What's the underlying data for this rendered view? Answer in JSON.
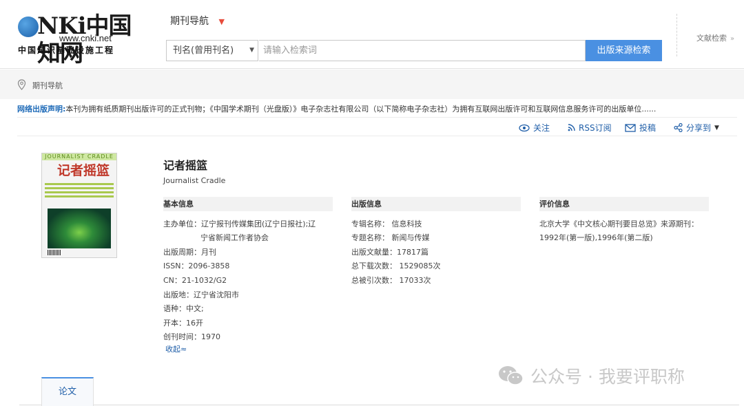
{
  "header": {
    "logo_brand": "CNKI中国知网",
    "logo_url": "www.cnki.net",
    "logo_sub": "中国知识基础设施工程",
    "nav_title": "期刊导航",
    "search_select": "刊名(曾用刊名)",
    "search_placeholder": "请输入检索词",
    "search_button": "出版来源检索",
    "lit_search": "文献检索"
  },
  "breadcrumb": {
    "label": "期刊导航"
  },
  "declaration": {
    "label": "网络出版声明:",
    "text": "本刊为拥有纸质期刊出版许可的正式刊物；《中国学术期刊（光盘版）》电子杂志社有限公司（以下简称电子杂志社）为拥有互联网出版许可和互联网信息服务许可的出版单位......"
  },
  "actions": {
    "follow": "关注",
    "rss": "RSS订阅",
    "submit": "投稿",
    "share": "分享到"
  },
  "cover": {
    "top_text": "JOURNALIST CRADLE",
    "logo_text": "记者摇篮"
  },
  "journal": {
    "title": "记者摇篮",
    "subtitle": "Journalist Cradle"
  },
  "basic": {
    "heading": "基本信息",
    "host_label": "主办单位：",
    "host_line1": "辽宁报刊传媒集团(辽宁日报社);辽",
    "host_line2": "宁省新闻工作者协会",
    "period": "出版周期：月刊",
    "issn": "ISSN：2096-3858",
    "cn": "CN：21-1032/G2",
    "place": "出版地：辽宁省沈阳市",
    "lang": "语种：中文;",
    "format": "开本：16开",
    "founded": "创刊时间：1970",
    "collapse": "收起≈"
  },
  "publish": {
    "heading": "出版信息",
    "album": "专辑名称：  信息科技",
    "topic": "专题名称：  新闻与传媒",
    "count": "出版文献量：17817篇",
    "downloads": "总下载次数：  1529085次",
    "citations": "总被引次数：  17033次"
  },
  "evaluation": {
    "heading": "评价信息",
    "line1": "北京大学《中文核心期刊要目总览》来源期刊：",
    "line2": "1992年(第一版),1996年(第二版)"
  },
  "tabs": {
    "papers": "论文"
  },
  "watermark": {
    "text": "公众号 · 我要评职称"
  },
  "colors": {
    "accent": "#4a90e2",
    "link": "#1f5ea8",
    "declaration_label": "#1f6bb8"
  }
}
